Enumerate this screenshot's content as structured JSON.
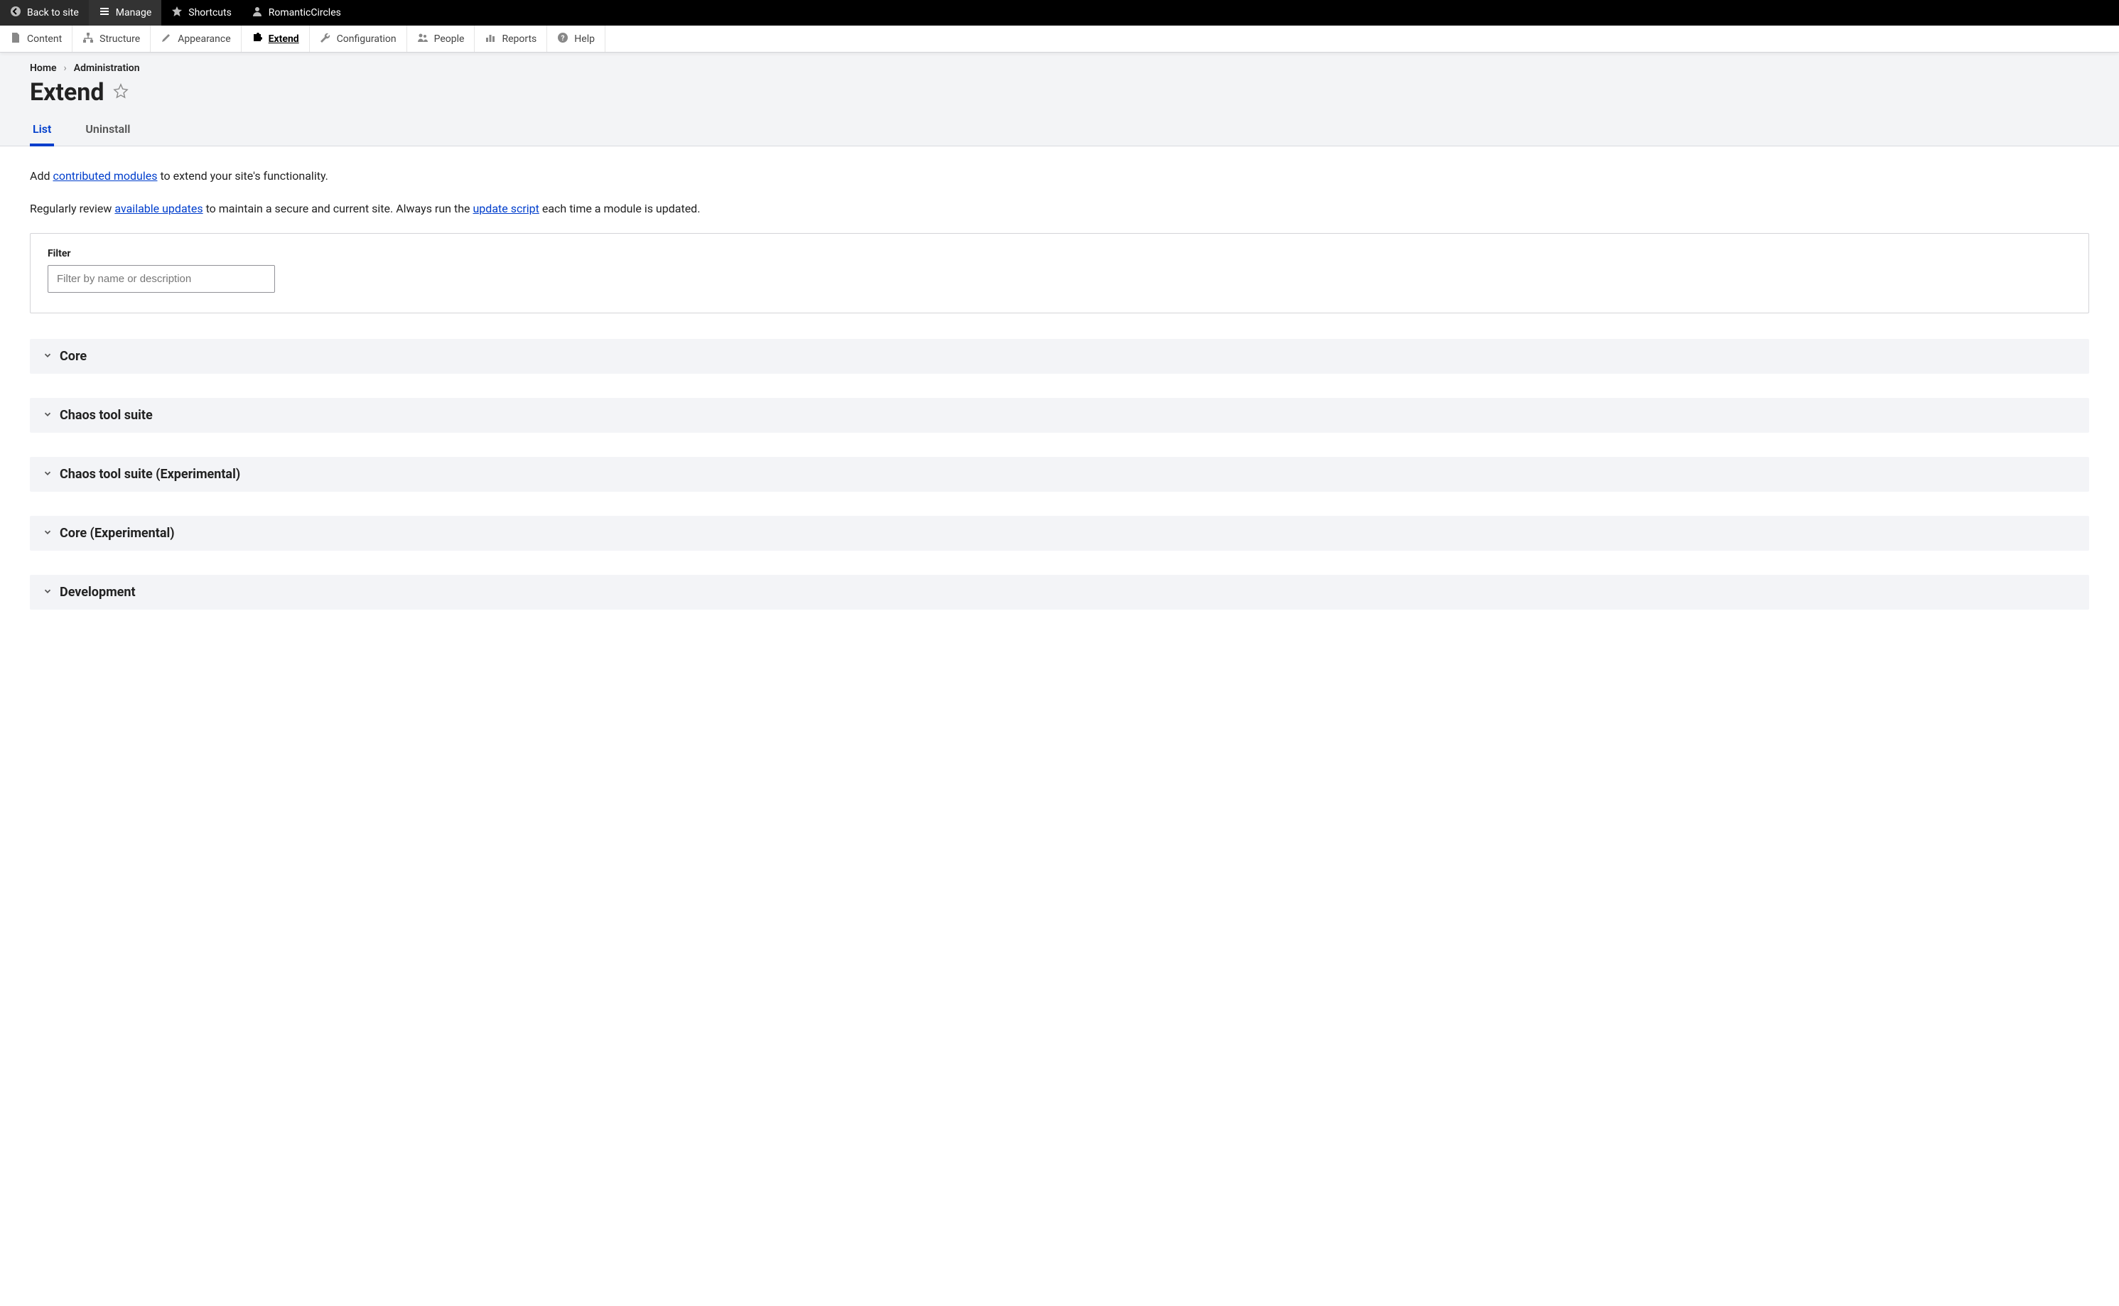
{
  "toolbar_top": {
    "back_to_site": "Back to site",
    "manage": "Manage",
    "shortcuts": "Shortcuts",
    "user": "RomanticCircles"
  },
  "toolbar_admin": {
    "content": "Content",
    "structure": "Structure",
    "appearance": "Appearance",
    "extend": "Extend",
    "configuration": "Configuration",
    "people": "People",
    "reports": "Reports",
    "help": "Help"
  },
  "breadcrumb": {
    "home": "Home",
    "administration": "Administration"
  },
  "page_title": "Extend",
  "tabs": {
    "list": "List",
    "uninstall": "Uninstall"
  },
  "intro": {
    "p1_pre": "Add ",
    "p1_link": "contributed modules",
    "p1_post": " to extend your site's functionality.",
    "p2_pre": "Regularly review ",
    "p2_link1": "available updates",
    "p2_mid": " to maintain a secure and current site. Always run the ",
    "p2_link2": "update script",
    "p2_post": " each time a module is updated."
  },
  "filter": {
    "label": "Filter",
    "placeholder": "Filter by name or description"
  },
  "sections": [
    {
      "title": "Core"
    },
    {
      "title": "Chaos tool suite"
    },
    {
      "title": "Chaos tool suite (Experimental)"
    },
    {
      "title": "Core (Experimental)"
    },
    {
      "title": "Development"
    }
  ]
}
